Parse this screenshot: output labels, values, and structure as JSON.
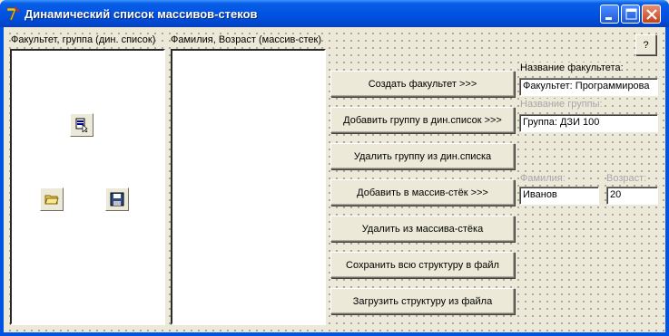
{
  "window": {
    "title": "Динамический список массивов-стеков"
  },
  "title_buttons": {
    "minimize": "minimize-icon",
    "maximize": "maximize-icon",
    "close": "close-icon"
  },
  "labels": {
    "faculty_group_list": "Факультет, группа (дин. список)",
    "name_age_list": "Фамилия, Возраст (массив-стек)",
    "faculty_name": "Название факультета:",
    "group_name": "Название группы:",
    "surname": "Фамилия:",
    "age": "Возраст:"
  },
  "buttons": {
    "help": "?",
    "create_faculty": "Создать факультет >>>",
    "add_group": "Добавить группу в дин.список >>>",
    "delete_group": "Удалить группу из дин.списка",
    "add_to_stack": "Добавить в массив-стёк >>>",
    "delete_from_stack": "Удалить из массива-стёка",
    "save_structure": "Сохранить всю структуру в файл",
    "load_structure": "Загрузить структуру из файла"
  },
  "fields": {
    "faculty_name": "Факультет: Программирова",
    "group_name": "Группа: ДЗИ 100",
    "surname": "Иванов",
    "age": "20"
  },
  "components": [
    "component-icon",
    "open-dialog-icon",
    "save-dialog-icon"
  ],
  "colors": {
    "titlebar": "#0054e3",
    "close_button": "#c4411b",
    "form_background": "#ece9d8"
  }
}
